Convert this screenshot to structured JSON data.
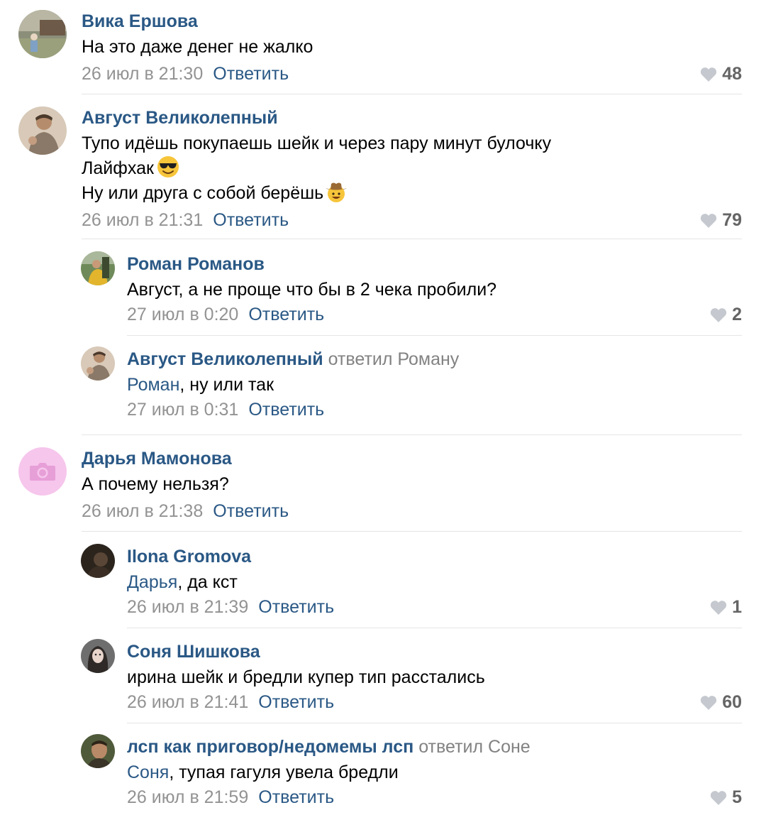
{
  "comments": [
    {
      "author": "Вика Ершова",
      "replied_to": "",
      "lines": [
        "На это даже денег не жалко"
      ],
      "date": "26 июл в 21:30",
      "reply_label": "Ответить",
      "likes": "48"
    },
    {
      "author": "Август Великолепный",
      "replied_to": "",
      "lines": [
        "Тупо идёшь покупаешь шейк и через пару минут булочку",
        "Лайфхак",
        "Ну или друга с собой берёшь"
      ],
      "emojis": [
        "smiling-face-with-sunglasses-emoji",
        "cowboy-hat-face-emoji"
      ],
      "date": "26 июл в 21:31",
      "reply_label": "Ответить",
      "likes": "79"
    },
    {
      "author": "Роман Романов",
      "replied_to": "",
      "lines": [
        "Август, а не проще что бы в 2 чека пробили?"
      ],
      "date": "27 июл в 0:20",
      "reply_label": "Ответить",
      "likes": "2"
    },
    {
      "author": "Август Великолепный",
      "replied_to": "ответил Роману",
      "mention": "Роман",
      "rest": ", ну или так",
      "date": "27 июл в 0:31",
      "reply_label": "Ответить",
      "likes": ""
    },
    {
      "author": "Дарья Мамонова",
      "replied_to": "",
      "lines": [
        "А почему нельзя?"
      ],
      "date": "26 июл в 21:38",
      "reply_label": "Ответить",
      "likes": ""
    },
    {
      "author": "Ilona Gromova",
      "replied_to": "",
      "mention": "Дарья",
      "rest": ", да кст",
      "date": "26 июл в 21:39",
      "reply_label": "Ответить",
      "likes": "1"
    },
    {
      "author": "Соня Шишкова",
      "replied_to": "",
      "lines": [
        "ирина шейк и бредли купер тип расстались"
      ],
      "date": "26 июл в 21:41",
      "reply_label": "Ответить",
      "likes": "60"
    },
    {
      "author": "лсп как приговор/недомемы лсп",
      "replied_to": "ответил Соне",
      "mention": "Соня",
      "rest": ", тупая гагуля увела бредли",
      "date": "26 июл в 21:59",
      "reply_label": "Ответить",
      "likes": "5"
    }
  ],
  "colors": {
    "author": "#2a5885",
    "date": "#939393",
    "likes": "#656565",
    "heart": "#c5c9cf",
    "divider": "#e5e5e5"
  },
  "icons": {
    "like": "heart-icon",
    "placeholder_avatar": "camera-icon"
  }
}
